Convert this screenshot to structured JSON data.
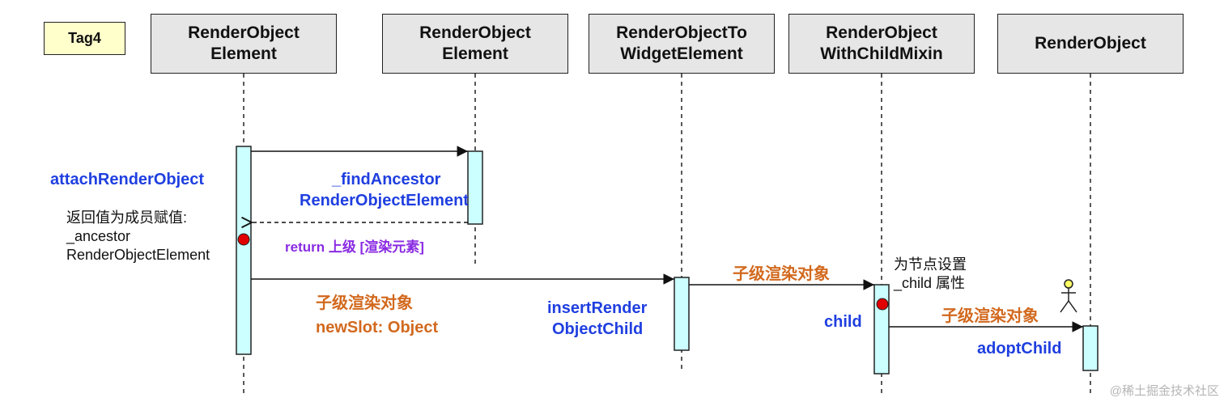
{
  "tag": "Tag4",
  "lifelines": [
    {
      "id": "ll1",
      "title": "RenderObject\nElement"
    },
    {
      "id": "ll2",
      "title": "RenderObject\nElement"
    },
    {
      "id": "ll3",
      "title": "RenderObjectTo\nWidgetElement"
    },
    {
      "id": "ll4",
      "title": "RenderObject\nWithChildMixin"
    },
    {
      "id": "ll5",
      "title": "RenderObject"
    }
  ],
  "methods": {
    "attach": "attachRenderObject",
    "find_line1": "_findAncestor",
    "find_line2": "RenderObjectElement",
    "insert_line1": "insertRender",
    "insert_line2": "ObjectChild",
    "child": "child",
    "adopt": "adoptChild"
  },
  "notes": {
    "return_assign": "返回值为成员赋值:\n_ancestor\nRenderObjectElement",
    "set_child": "为节点设置\n_child 属性"
  },
  "messages": {
    "return_label": "return  上级 [渲染元素]",
    "child_render_object_1": "子级渲染对象",
    "new_slot": "newSlot: Object",
    "child_render_object_2": "子级渲染对象",
    "child_render_object_3": "子级渲染对象"
  },
  "colors": {
    "method": "#1f3fe0",
    "message": "#d2691e",
    "return": "#8a2be2",
    "activation": "#ccffff",
    "header": "#e6e6e6",
    "tag": "#ffffcc",
    "marker": "#e00000"
  },
  "watermark": "@稀土掘金技术社区"
}
